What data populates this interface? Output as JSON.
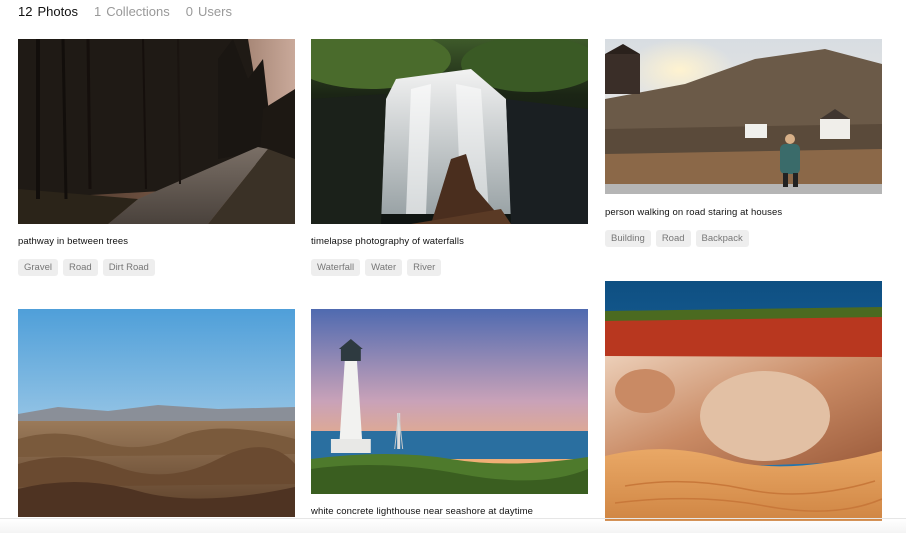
{
  "tabs": [
    {
      "count": "12",
      "label": "Photos",
      "active": true
    },
    {
      "count": "1",
      "label": "Collections",
      "active": false
    },
    {
      "count": "0",
      "label": "Users",
      "active": false
    }
  ],
  "cards": [
    {
      "caption": "pathway in between trees",
      "tags": [
        "Gravel",
        "Road",
        "Dirt Road"
      ]
    },
    {
      "caption": "timelapse photography of waterfalls",
      "tags": [
        "Waterfall",
        "Water",
        "River"
      ]
    },
    {
      "caption": "person walking on road staring at houses",
      "tags": [
        "Building",
        "Road",
        "Backpack"
      ]
    },
    {
      "caption": "",
      "tags": []
    },
    {
      "caption": "white concrete lighthouse near seashore at daytime",
      "tags": []
    },
    {
      "caption": "",
      "tags": []
    }
  ]
}
